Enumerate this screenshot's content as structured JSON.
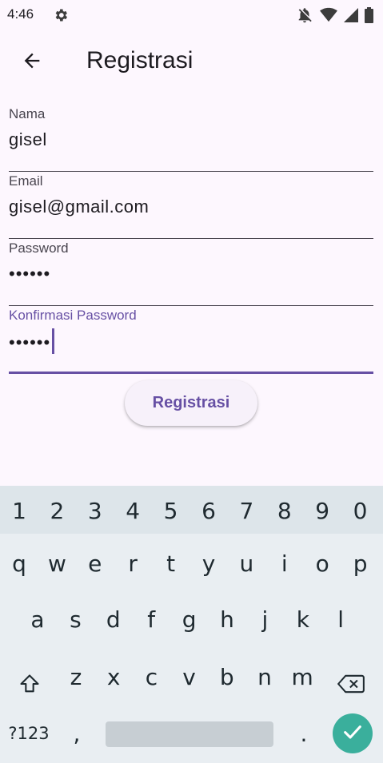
{
  "status_bar": {
    "time": "4:46",
    "icons": [
      "gear-icon",
      "notifications-off-icon",
      "wifi-icon",
      "signal-icon",
      "battery-icon"
    ]
  },
  "app_bar": {
    "back_icon": "arrow-back-icon",
    "title": "Registrasi"
  },
  "form": {
    "name": {
      "label": "Nama",
      "value": "gisel"
    },
    "email": {
      "label": "Email",
      "value": "gisel@gmail.com"
    },
    "password": {
      "label": "Password",
      "value": "••••••"
    },
    "confirm_password": {
      "label": "Konfirmasi Password",
      "value": "••••••"
    },
    "submit_label": "Registrasi"
  },
  "colors": {
    "background": "#fdf7fe",
    "accent": "#6750a4",
    "keyboard_bg": "#e9eef2",
    "enter_key": "#3aaf9c"
  },
  "keyboard": {
    "number_row": [
      "1",
      "2",
      "3",
      "4",
      "5",
      "6",
      "7",
      "8",
      "9",
      "0"
    ],
    "row1": [
      "q",
      "w",
      "e",
      "r",
      "t",
      "y",
      "u",
      "i",
      "o",
      "p"
    ],
    "row2": [
      "a",
      "s",
      "d",
      "f",
      "g",
      "h",
      "j",
      "k",
      "l"
    ],
    "row3": [
      "z",
      "x",
      "c",
      "v",
      "b",
      "n",
      "m"
    ],
    "symbols_key": "?123",
    "comma_key": ",",
    "period_key": ".",
    "shift_icon": "shift-icon",
    "backspace_icon": "backspace-icon",
    "enter_icon": "check-icon"
  }
}
